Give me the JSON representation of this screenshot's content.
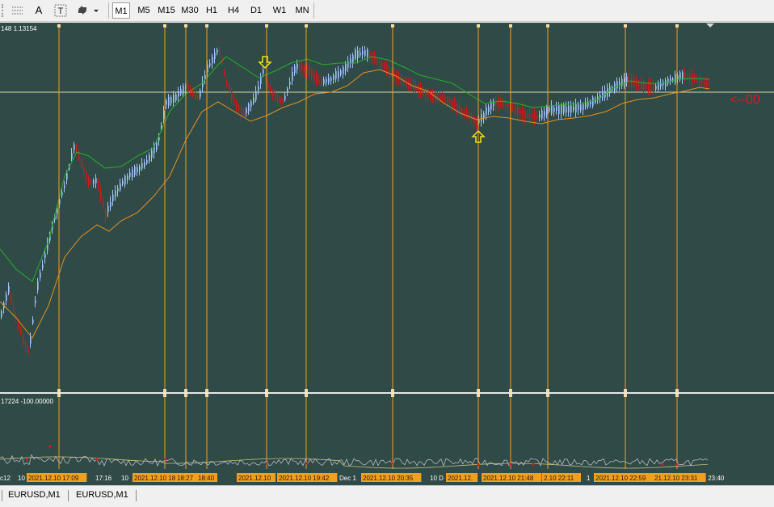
{
  "toolbar": {
    "timeframes": [
      {
        "label": "M1",
        "active": true
      },
      {
        "label": "M5",
        "active": false
      },
      {
        "label": "M15",
        "active": false
      },
      {
        "label": "M30",
        "active": false
      },
      {
        "label": "H1",
        "active": false
      },
      {
        "label": "H4",
        "active": false
      },
      {
        "label": "D1",
        "active": false
      },
      {
        "label": "W1",
        "active": false
      },
      {
        "label": "MN",
        "active": false
      }
    ],
    "text_tool_label": "A"
  },
  "main_chart": {
    "price_info": "148 1.13154",
    "signal_text": "<--00",
    "colors": {
      "background": "#2f4a47",
      "vline": "#f0a020",
      "green_line": "#22b522",
      "orange_line": "#e89020",
      "arrow": "#f2e21a",
      "signal": "#e01818"
    }
  },
  "indicator_panel": {
    "label": "17224 -100.00000"
  },
  "time_axis": {
    "labels": [
      "c12",
      "10",
      "17:16",
      "10",
      "Dec 1",
      "10 D",
      "1",
      "c 23:40"
    ],
    "highlighted_labels": [
      "2021.12.10 17:09",
      "2021.12.10 18:14",
      "18:27",
      "18:40",
      "2021.12.10",
      "2021.12.10 19:42",
      "2021.12.10 20:35",
      "2021.12.",
      "2021.12.10 21:48",
      "2.10 22:11",
      "2021.12.10 22:59",
      "21.12.10 23:31"
    ]
  },
  "bottom_tabs": [
    "EURUSD,M1",
    "EURUSD,M1"
  ]
}
